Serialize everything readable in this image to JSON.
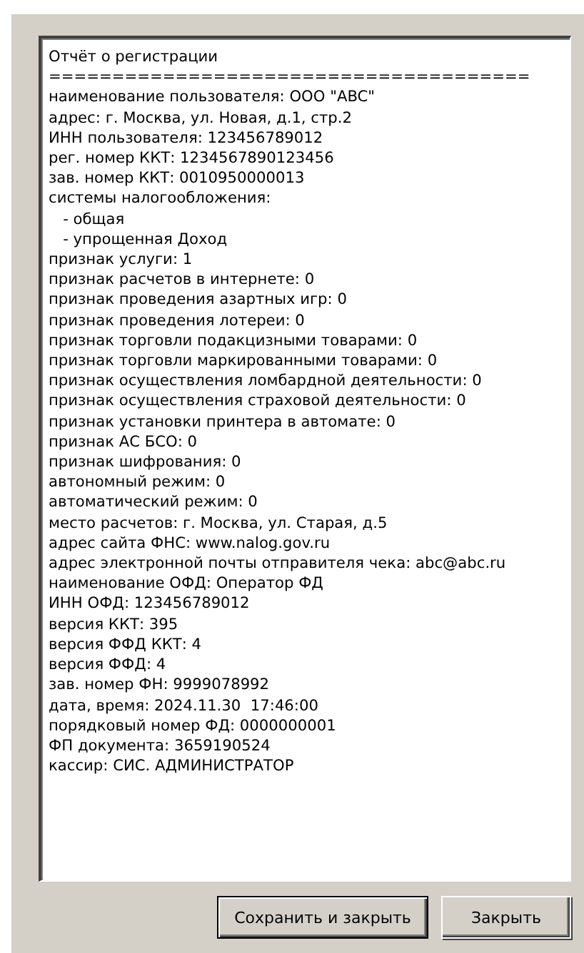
{
  "report": {
    "lines": [
      "Отчёт о регистрации",
      "======================================",
      "наименование пользователя: ООО \"ABC\"",
      "адрес: г. Москва, ул. Новая, д.1, стр.2",
      "ИНН пользователя: 123456789012",
      "рег. номер ККТ: 1234567890123456",
      "зав. номер ККТ: 0010950000013",
      "системы налогообложения:",
      "   - общая",
      "   - упрощенная Доход",
      "признак услуги: 1",
      "признак расчетов в интернете: 0",
      "признак проведения азартных игр: 0",
      "признак проведения лотереи: 0",
      "признак торговли подакцизными товарами: 0",
      "признак торговли маркированными товарами: 0",
      "признак осуществления ломбардной деятельности: 0",
      "признак осуществления страховой деятельности: 0",
      "признак установки принтера в автомате: 0",
      "признак АС БСО: 0",
      "признак шифрования: 0",
      "автономный режим: 0",
      "автоматический режим: 0",
      "место расчетов: г. Москва, ул. Старая, д.5",
      "адрес сайта ФНС: www.nalog.gov.ru",
      "адрес электронной почты отправителя чека: abc@abc.ru",
      "наименование ОФД: Оператор ФД",
      "ИНН ОФД: 123456789012",
      "версия ККТ: 395",
      "версия ФФД ККТ: 4",
      "версия ФФД: 4",
      "зав. номер ФН: 9999078992",
      "дата, время: 2024.11.30  17:46:00",
      "порядковый номер ФД: 0000000001",
      "ФП документа: 3659190524",
      "кассир: СИС. АДМИНИСТРАТОР"
    ]
  },
  "buttons": [
    {
      "label": "Сохранить и закрыть",
      "default": true
    },
    {
      "label": "Закрыть",
      "default": false
    }
  ]
}
